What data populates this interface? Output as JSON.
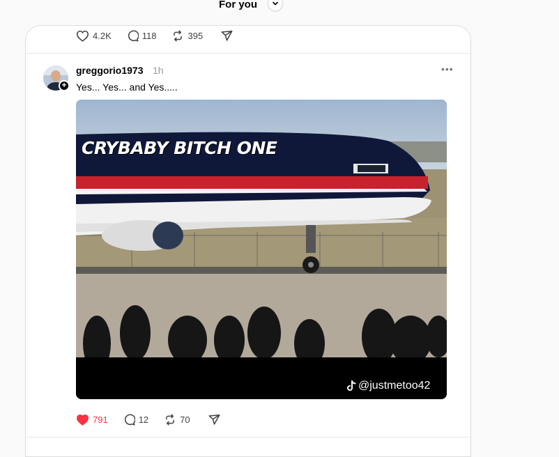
{
  "header": {
    "feed_title": "For you"
  },
  "previous_post": {
    "likes": "4.2K",
    "replies": "118",
    "reposts": "395"
  },
  "post": {
    "username": "greggorio1973",
    "timestamp": "1h",
    "text": "Yes... Yes... and Yes.....",
    "media_caption": "CRYBABY BITCH ONE",
    "watermark": "@justmetoo42",
    "likes": "791",
    "liked": true,
    "replies": "12",
    "reposts": "70"
  },
  "colors": {
    "like_active": "#ff3040",
    "text_muted": "#999999"
  },
  "icons": [
    "chevron-down-icon",
    "heart-icon",
    "comment-icon",
    "repost-icon",
    "share-icon",
    "more-icon",
    "tiktok-icon",
    "follow-plus-icon"
  ]
}
